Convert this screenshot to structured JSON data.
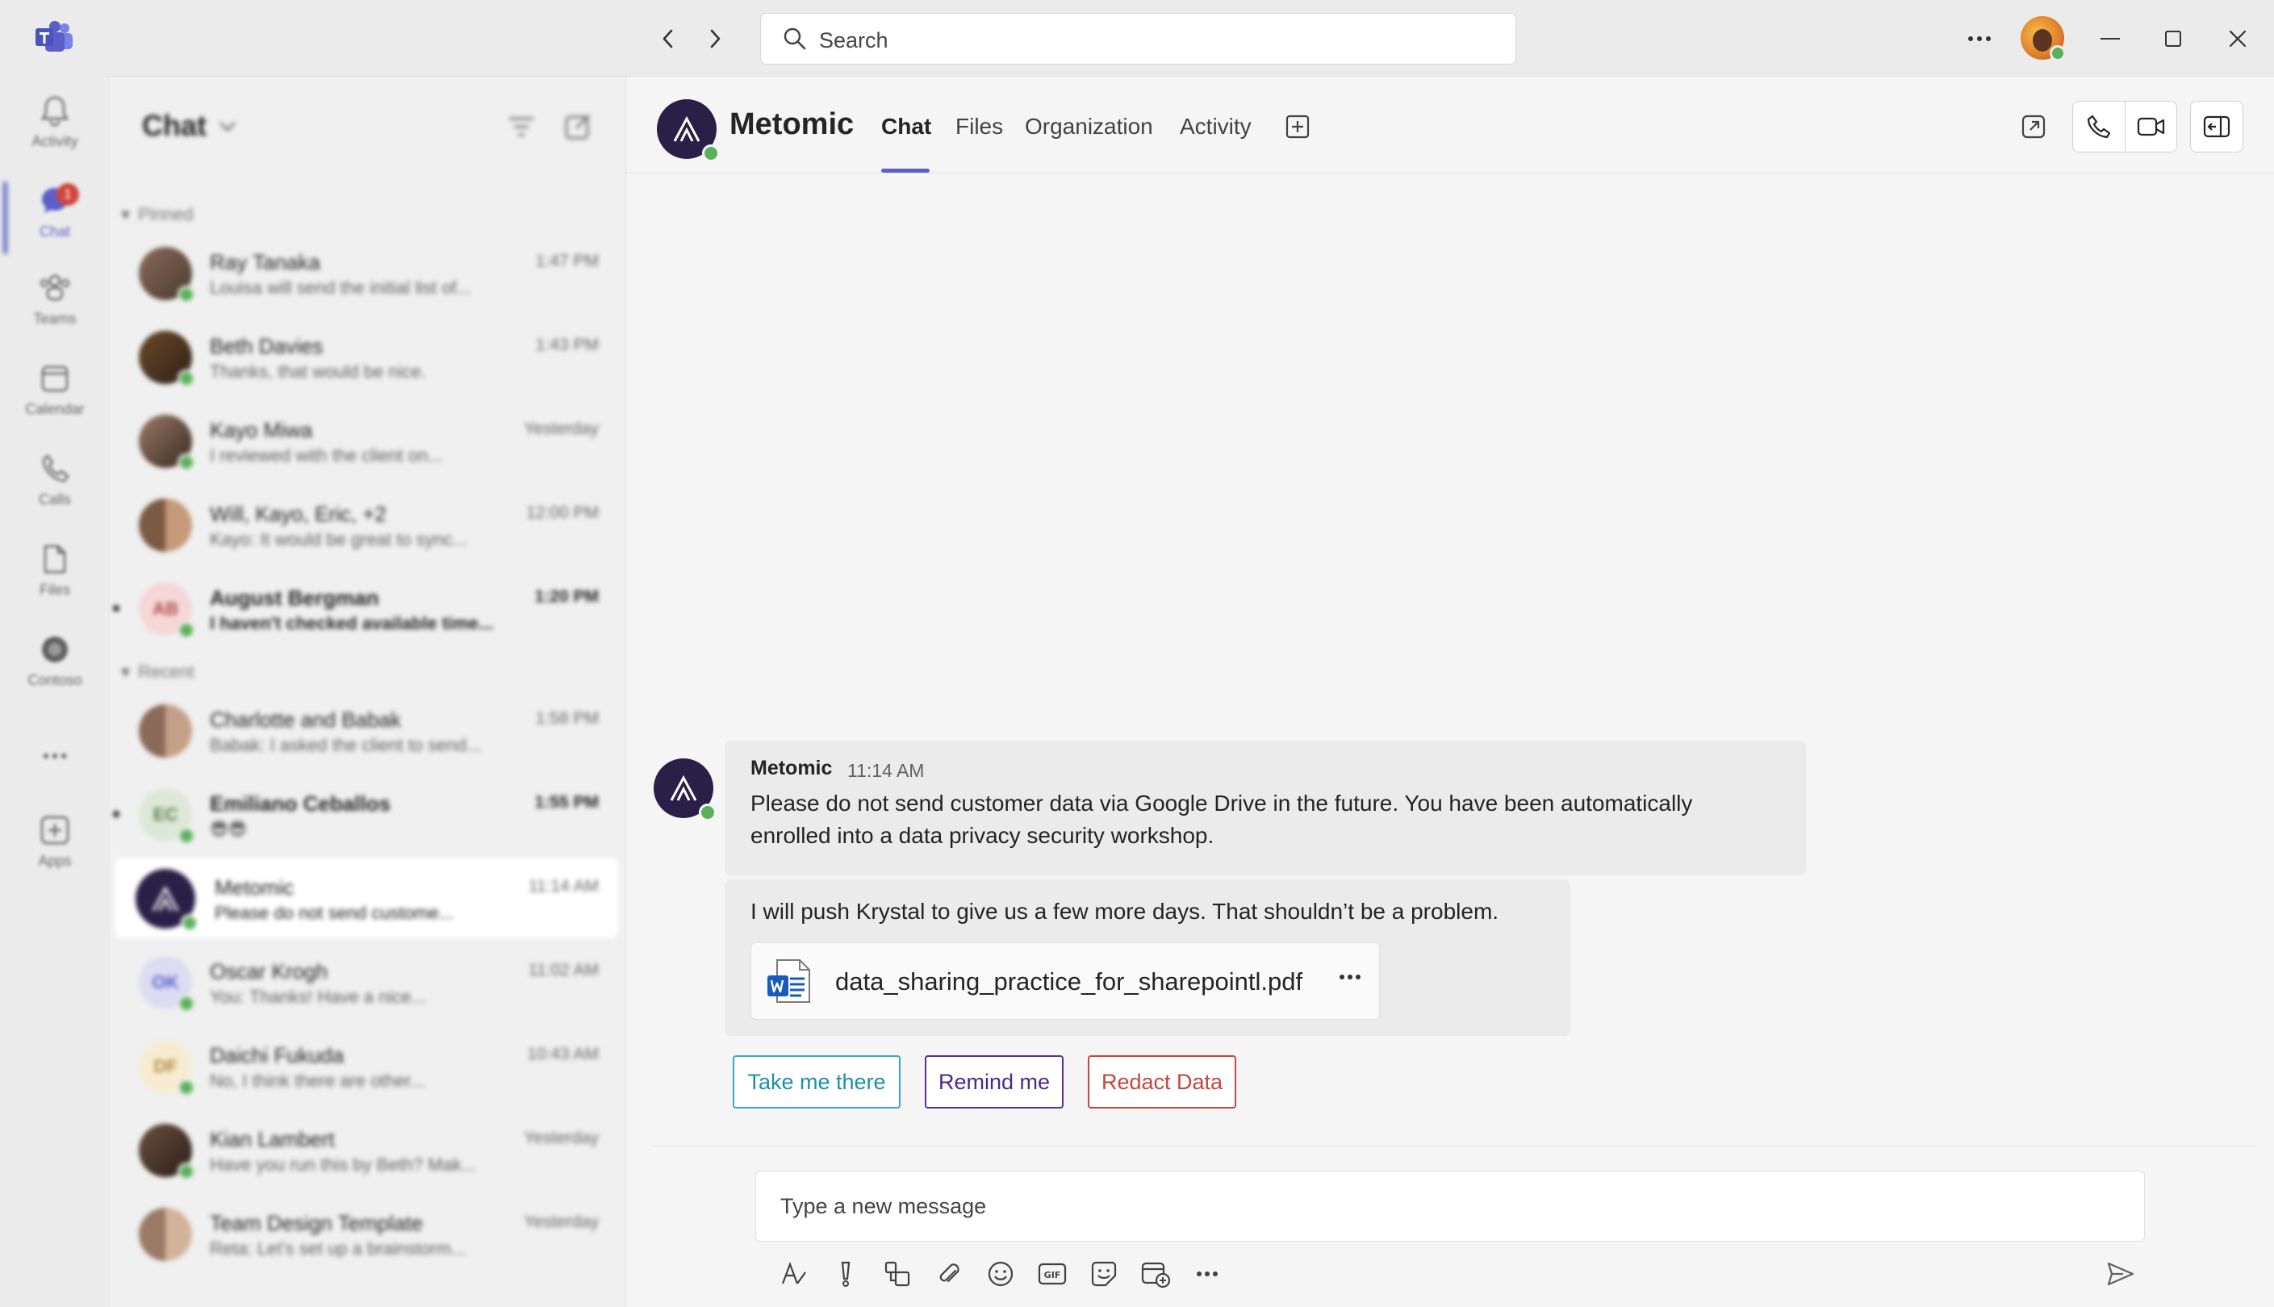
{
  "titlebar": {
    "search_placeholder": "Search"
  },
  "rail": {
    "items": [
      {
        "label": "Activity",
        "icon": "bell-icon"
      },
      {
        "label": "Chat",
        "icon": "chat-icon",
        "badge": "1"
      },
      {
        "label": "Teams",
        "icon": "teams-icon"
      },
      {
        "label": "Calendar",
        "icon": "calendar-icon"
      },
      {
        "label": "Calls",
        "icon": "phone-icon"
      },
      {
        "label": "Files",
        "icon": "file-icon"
      },
      {
        "label": "Contoso",
        "icon": "contoso-icon"
      },
      {
        "label": "...",
        "icon": "more-icon"
      },
      {
        "label": "Apps",
        "icon": "apps-icon"
      }
    ]
  },
  "chatlist": {
    "title": "Chat",
    "pinned_label": "Pinned",
    "recent_label": "Recent",
    "pinned": [
      {
        "name": "Ray Tanaka",
        "time": "1:47 PM",
        "preview": "Louisa will send the initial list of..."
      },
      {
        "name": "Beth Davies",
        "time": "1:43 PM",
        "preview": "Thanks, that would be nice."
      },
      {
        "name": "Kayo Miwa",
        "time": "Yesterday",
        "preview": "I reviewed with the client on..."
      },
      {
        "name": "Will, Kayo, Eric, +2",
        "time": "12:00 PM",
        "preview": "Kayo: It would be great to sync..."
      },
      {
        "name": "August Bergman",
        "time": "1:20 PM",
        "preview": "I haven't checked available time...",
        "initials": "AB"
      }
    ],
    "recent": [
      {
        "name": "Charlotte and Babak",
        "time": "1:58 PM",
        "preview": "Babak: I asked the client to send..."
      },
      {
        "name": "Emiliano Ceballos",
        "time": "1:55 PM",
        "preview": "😎😎",
        "initials": "EC"
      },
      {
        "name": "Metomic",
        "time": "11:14 AM",
        "preview": "Please do not send custome..."
      },
      {
        "name": "Oscar Krogh",
        "time": "11:02 AM",
        "preview": "You: Thanks! Have a nice...",
        "initials": "OK"
      },
      {
        "name": "Daichi Fukuda",
        "time": "10:43 AM",
        "preview": "No, I think there are other...",
        "initials": "DF"
      },
      {
        "name": "Kian Lambert",
        "time": "Yesterday",
        "preview": "Have you run this by Beth? Mak..."
      },
      {
        "name": "Team Design Template",
        "time": "Yesterday",
        "preview": "Reta: Let's set up a brainstorm..."
      }
    ]
  },
  "header": {
    "name": "Metomic",
    "tabs": [
      "Chat",
      "Files",
      "Organization",
      "Activity"
    ]
  },
  "messages": {
    "sender": "Metomic",
    "time": "11:14 AM",
    "text_line1": "Please do not send customer data via Google Drive in the future. You have been automatically",
    "text_line2": "enrolled into a data privacy security workshop.",
    "quoted_text": "I will push Krystal to give us a few more days. That shouldn’t be a problem.",
    "file_name": "data_sharing_practice_for_sharepointl.pdf",
    "actions": [
      "Take me there",
      "Remind me",
      "Redact Data"
    ]
  },
  "compose": {
    "placeholder": "Type a new message"
  },
  "colors": {
    "brand": "#5b5fc7",
    "presence": "#5bb05a",
    "action_teal": "#1f8ea9",
    "action_purple": "#4b2b86",
    "action_red": "#c4463c"
  }
}
